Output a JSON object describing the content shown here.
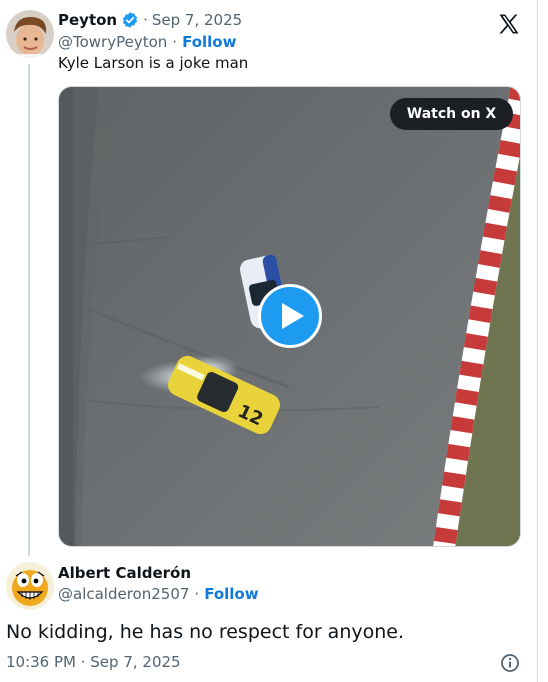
{
  "tweet": {
    "author_name": "Peyton",
    "date": "Sep 7, 2025",
    "handle": "@TowryPeyton",
    "follow": "Follow",
    "text": "Kyle Larson is a joke man",
    "watch_label": "Watch on X"
  },
  "reply": {
    "author_name": "Albert Calderón",
    "handle": "@alcalderon2507",
    "follow": "Follow",
    "text": "No kidding, he has no respect for anyone.",
    "timestamp": "10:36 PM · Sep 7, 2025"
  },
  "separator": "·",
  "colors": {
    "accent": "#1d9bf0",
    "verified": "#1d9bf0",
    "follow": "#0f7ad8",
    "muted": "#536471"
  },
  "icons": [
    "x-logo-icon",
    "verified-badge-icon",
    "play-icon",
    "info-icon"
  ]
}
